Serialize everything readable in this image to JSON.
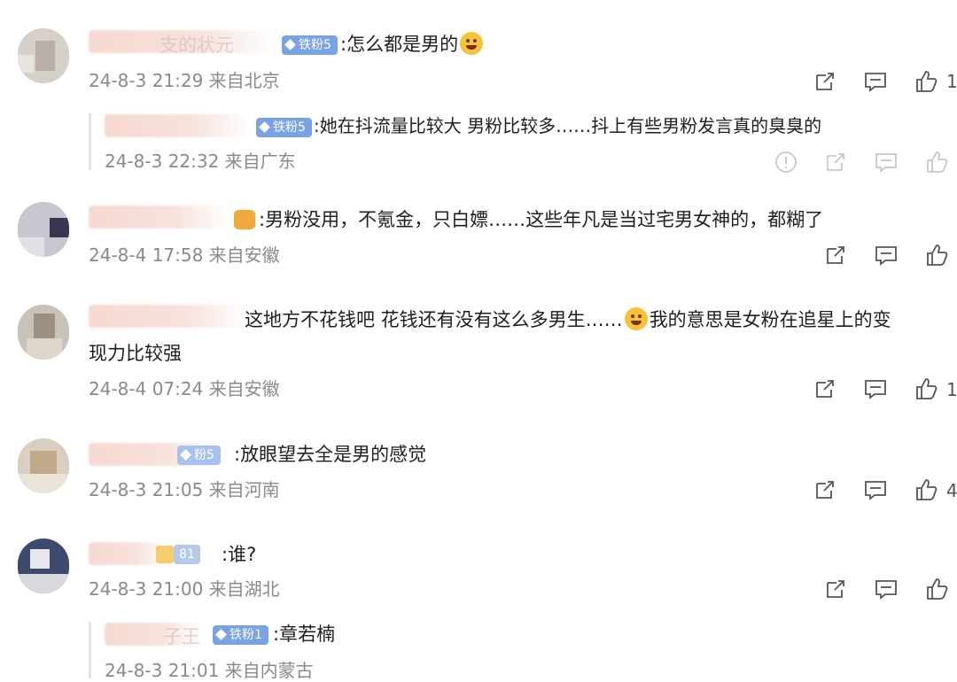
{
  "comments": [
    {
      "name_fragment": "支的状元",
      "badge": "铁粉5",
      "text": ":怎么都是男的",
      "meta": "24-8-3 21:29 来自北京",
      "like_count": "1",
      "replies": [
        {
          "badge": "铁粉5",
          "text": ":她在抖流量比较大 男粉比较多……抖上有些男粉发言真的臭臭的",
          "meta": "24-8-3 22:32 来自广东"
        }
      ]
    },
    {
      "text": ":男粉没用，不氪金，只白嫖……这些年凡是当过宅男女神的，都糊了",
      "meta": "24-8-4 17:58 来自安徽",
      "like_count": ""
    },
    {
      "text_line1": "这地方不花钱吧  花钱还有没有这么多男生……",
      "text_line1b": "我的意思是女粉在追星上的变",
      "text_line2": "现力比较强",
      "meta": "24-8-4 07:24 来自安徽",
      "like_count": "1"
    },
    {
      "badge": "粉5",
      "text": ":放眼望去全是男的感觉",
      "meta": "24-8-3 21:05 来自河南",
      "like_count": "4"
    },
    {
      "badge": "81",
      "text": ":谁?",
      "meta": "24-8-3 21:00 来自湖北",
      "like_count": "",
      "replies": [
        {
          "name_fragment": "子王",
          "badge": "铁粉1",
          "text": ":章若楠",
          "meta": "24-8-3 21:01 来自内蒙古"
        }
      ]
    }
  ],
  "icons": {
    "share": "share-icon",
    "comment": "comment-icon",
    "like": "like-icon",
    "report": "report-icon"
  },
  "colors": {
    "badge": "#7aa3e6",
    "meta": "#8a8a8a",
    "text": "#1e1e1e"
  }
}
